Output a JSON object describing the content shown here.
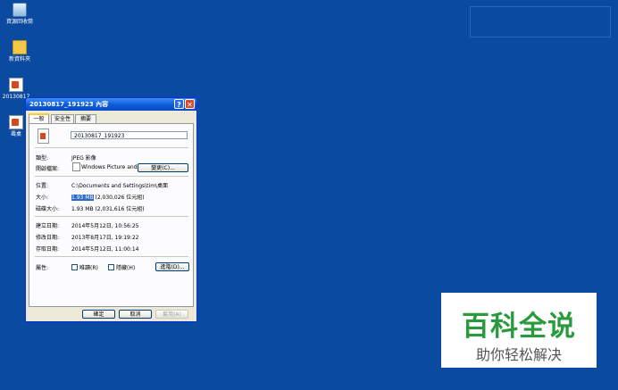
{
  "desktop": {
    "icons": [
      {
        "label": "資源回收筒",
        "icon": "recycle-bin-icon"
      },
      {
        "label": "新資料夾",
        "icon": "folder-icon"
      },
      {
        "label": "20130817",
        "icon": "jpeg-file-icon"
      },
      {
        "label": "壽桌",
        "icon": "jpeg-file-icon"
      }
    ]
  },
  "dialog": {
    "title": "20130817_191923 內容",
    "help_glyph": "?",
    "close_glyph": "✕",
    "tabs": [
      {
        "label": "一般",
        "active": true
      },
      {
        "label": "安全性",
        "active": false
      },
      {
        "label": "摘要",
        "active": false
      }
    ],
    "filename": "20130817_191923",
    "type_label": "類型:",
    "type_value": "JPEG 影像",
    "opens_with_label": "開啟檔案:",
    "opens_with_value": "Windows Picture and Fa",
    "change_button": "變更(C)...",
    "location_label": "位置:",
    "location_value": "C:\\Documents and Settings\\tim\\桌面",
    "size_label": "大小:",
    "size_value_highlight": "1.93 MB",
    "size_value_rest": "(2,030,026 位元組)",
    "size_on_disk_label": "磁碟大小:",
    "size_on_disk_value": "1.93 MB (2,031,616 位元組)",
    "created_label": "建立日期:",
    "created_value": "2014年5月12日, 10:56:25",
    "modified_label": "修改日期:",
    "modified_value": "2013年8月17日, 19:19:22",
    "accessed_label": "存取日期:",
    "accessed_value": "2014年5月12日, 11:00:14",
    "attributes_label": "屬性:",
    "readonly_label": "唯讀(R)",
    "hidden_label": "隱藏(H)",
    "advanced_button": "進階(D)...",
    "ok_button": "確定",
    "cancel_button": "取消",
    "apply_button": "套用(A)"
  },
  "watermark": {
    "title": "百科全说",
    "subtitle": "助你轻松解决"
  }
}
